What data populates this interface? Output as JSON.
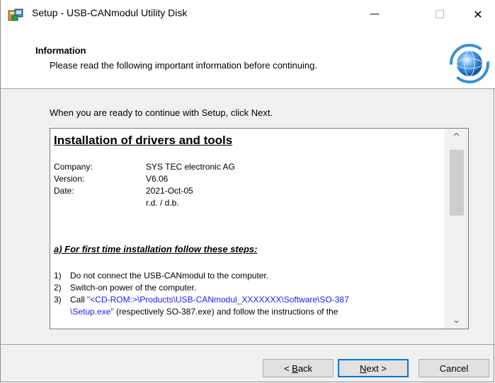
{
  "window": {
    "title": "Setup - USB-CANmodul Utility Disk",
    "minimize_glyph": "—",
    "maximize_glyph": "☐",
    "close_glyph": "✕"
  },
  "header": {
    "title": "Information",
    "subtitle": "Please read the following important information before continuing."
  },
  "instruction": "When you are ready to continue with Setup, click Next.",
  "document": {
    "title": "Installation of drivers and tools",
    "info": [
      {
        "label": "Company:",
        "value": "SYS TEC electronic AG"
      },
      {
        "label": "Version:",
        "value": "V6.06"
      },
      {
        "label": "Date:",
        "value": "2021-Oct-05"
      },
      {
        "label": "",
        "value": "r.d. / d.b."
      }
    ],
    "section_heading": "a) For first time installation follow these steps:",
    "steps": [
      {
        "num": "1)",
        "text": "Do not connect the USB-CANmodul to the computer."
      },
      {
        "num": "2)",
        "text": "Switch-on power of the computer."
      },
      {
        "num": "3)",
        "prefix": "Call ",
        "path1": "\"<CD-ROM:>\\Products\\USB-CANmodul_XXXXXXX\\Software\\SO-387",
        "path2": "\\Setup.exe\"",
        "suffix": " (respectively SO-387.exe) and follow the instructions of the"
      }
    ]
  },
  "scrollbar": {
    "up_glyph": "^",
    "down_glyph": "⌄",
    "position": 0.0
  },
  "buttons": {
    "back_accel": "B",
    "back_rest": "ack",
    "back_prefix": "< ",
    "next_accel": "N",
    "next_rest": "ext >",
    "cancel": "Cancel"
  },
  "colors": {
    "link": "#1a1aff",
    "default_button_border": "#0078d7"
  }
}
